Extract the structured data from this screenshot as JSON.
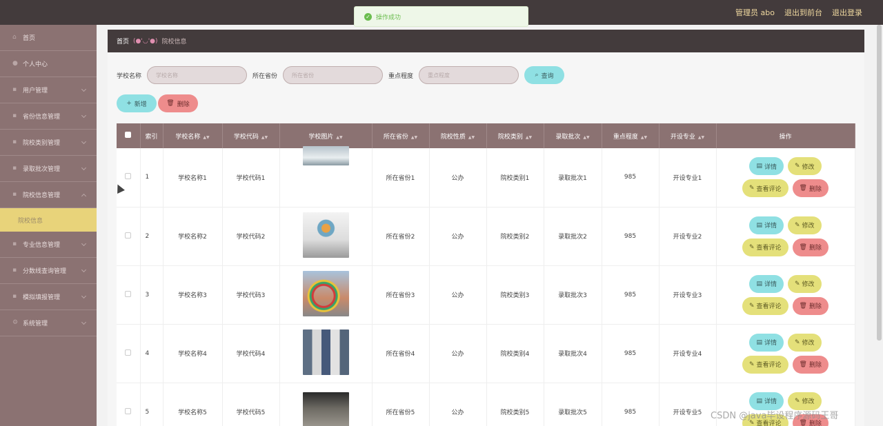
{
  "topbar": {
    "admin": "管理员 abo",
    "front": "退出到前台",
    "logout": "退出登录"
  },
  "toast": {
    "message": "操作成功"
  },
  "sidebar": {
    "items": [
      {
        "label": "首页",
        "icon": "home-icon"
      },
      {
        "label": "个人中心",
        "icon": "user-icon"
      },
      {
        "label": "用户管理",
        "icon": "users-icon"
      },
      {
        "label": "省份信息管理",
        "icon": "list-icon"
      },
      {
        "label": "院校类别管理",
        "icon": "list-icon"
      },
      {
        "label": "录取批次管理",
        "icon": "list-icon"
      },
      {
        "label": "院校信息管理",
        "icon": "list-icon"
      },
      {
        "label": "院校信息",
        "icon": "",
        "sub": true
      },
      {
        "label": "专业信息管理",
        "icon": "list-icon"
      },
      {
        "label": "分数线查询管理",
        "icon": "list-icon"
      },
      {
        "label": "模拟填报管理",
        "icon": "list-icon"
      },
      {
        "label": "系统管理",
        "icon": "gear-icon"
      }
    ]
  },
  "breadcrumb": {
    "home": "首页",
    "face": "(●'◡'●)",
    "current": "院校信息"
  },
  "search": {
    "school_label": "学校名称",
    "school_placeholder": "学校名称",
    "province_label": "所在省份",
    "province_placeholder": "所在省份",
    "level_label": "重点程度",
    "level_placeholder": "重点程度",
    "query": "查询"
  },
  "actions": {
    "add": "新增",
    "delete": "删除"
  },
  "table": {
    "headers": [
      "索引",
      "学校名称",
      "学校代码",
      "学校图片",
      "所在省份",
      "院校性质",
      "院校类别",
      "录取批次",
      "重点程度",
      "开设专业",
      "操作"
    ],
    "rows": [
      {
        "index": "1",
        "name": "学校名称1",
        "code": "学校代码1",
        "province": "所在省份1",
        "nature": "公办",
        "category": "院校类别1",
        "batch": "录取批次1",
        "level": "985",
        "major": "开设专业1"
      },
      {
        "index": "2",
        "name": "学校名称2",
        "code": "学校代码2",
        "province": "所在省份2",
        "nature": "公办",
        "category": "院校类别2",
        "batch": "录取批次2",
        "level": "985",
        "major": "开设专业2"
      },
      {
        "index": "3",
        "name": "学校名称3",
        "code": "学校代码3",
        "province": "所在省份3",
        "nature": "公办",
        "category": "院校类别3",
        "batch": "录取批次3",
        "level": "985",
        "major": "开设专业3"
      },
      {
        "index": "4",
        "name": "学校名称4",
        "code": "学校代码4",
        "province": "所在省份4",
        "nature": "公办",
        "category": "院校类别4",
        "batch": "录取批次4",
        "level": "985",
        "major": "开设专业4"
      },
      {
        "index": "5",
        "name": "学校名称5",
        "code": "学校代码5",
        "province": "所在省份5",
        "nature": "公办",
        "category": "院校类别5",
        "batch": "录取批次5",
        "level": "985",
        "major": "开设专业5"
      }
    ],
    "ops": {
      "detail": "详情",
      "edit": "修改",
      "comment": "查看评论",
      "delete": "删除"
    }
  },
  "watermark": "CSDN @java毕设程序源码王哥",
  "colors": {
    "topbar": "#433b3c",
    "sidebar": "#8b7272",
    "accent_cyan": "#8fe0e3",
    "accent_yellow": "#e4e07a",
    "accent_red": "#ee8c8c"
  }
}
